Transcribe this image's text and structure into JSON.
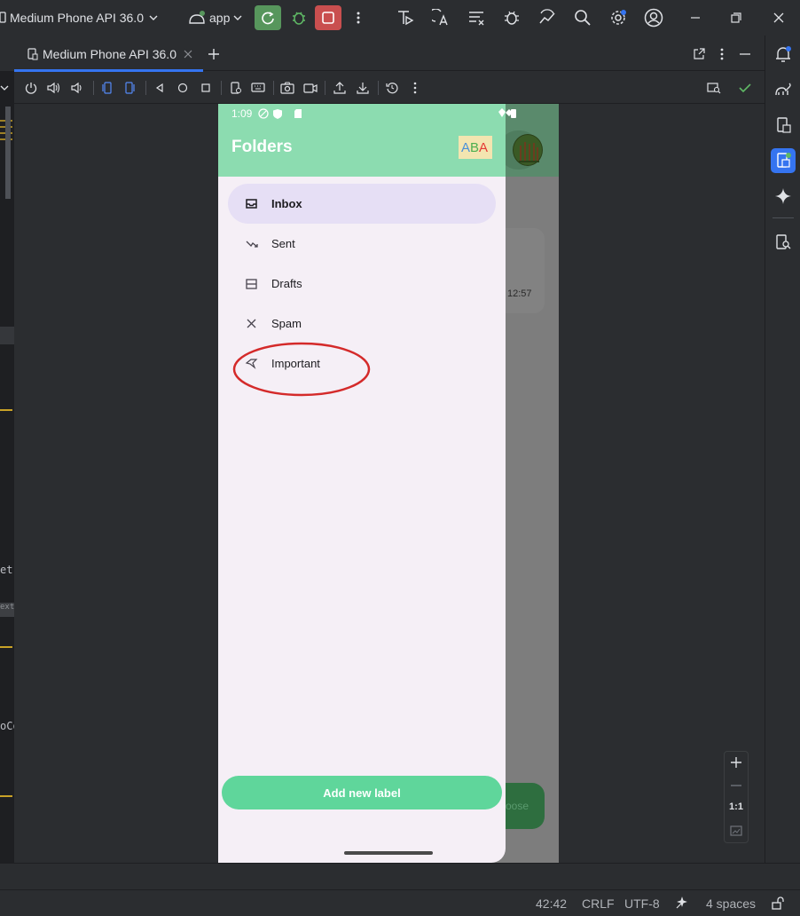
{
  "titlebar": {
    "device_name": "Medium Phone API 36.0",
    "run_config": "app"
  },
  "tool_window": {
    "tab_label": "Medium Phone API 36.0"
  },
  "phone": {
    "status_time": "1:09",
    "drawer_title": "Folders",
    "logo_text": "ABA",
    "nav_items": [
      {
        "label": "Inbox",
        "icon": "inbox-icon",
        "active": true
      },
      {
        "label": "Sent",
        "icon": "sent-icon",
        "active": false
      },
      {
        "label": "Drafts",
        "icon": "drafts-icon",
        "active": false
      },
      {
        "label": "Spam",
        "icon": "spam-icon",
        "active": false
      },
      {
        "label": "Important",
        "icon": "important-icon",
        "active": false
      }
    ],
    "add_label_button": "Add new label",
    "bg_card_time": "12:57",
    "bg_fab_label": "oose"
  },
  "zoom": {
    "ratio_label": "1:1"
  },
  "editor_gutter": {
    "fragment_1": "et",
    "fragment_2": "ext:",
    "fragment_3": "oCo"
  },
  "statusbar": {
    "position": "42:42",
    "line_ending": "CRLF",
    "encoding": "UTF-8",
    "indent": "4 spaces"
  },
  "colors": {
    "drawer_header": "#8cdcb0",
    "active_nav": "#e6dff5",
    "add_button": "#5fd69b",
    "annotation": "#d42a2a",
    "run_green": "#57965c",
    "stop_red": "#c94f4f"
  }
}
